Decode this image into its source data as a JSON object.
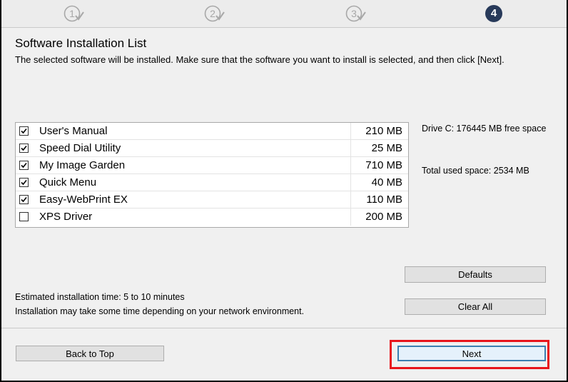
{
  "steps": [
    {
      "number": "1",
      "state": "done"
    },
    {
      "number": "2",
      "state": "done"
    },
    {
      "number": "3",
      "state": "done"
    },
    {
      "number": "4",
      "state": "current"
    }
  ],
  "header": {
    "title": "Software Installation List",
    "description": "The selected software will be installed. Make sure that the software you want to install is selected, and then click [Next]."
  },
  "software": [
    {
      "name": "User's Manual",
      "size": "210 MB",
      "checked": true
    },
    {
      "name": "Speed Dial Utility",
      "size": "25 MB",
      "checked": true
    },
    {
      "name": "My Image Garden",
      "size": "710 MB",
      "checked": true
    },
    {
      "name": "Quick Menu",
      "size": "40 MB",
      "checked": true
    },
    {
      "name": "Easy-WebPrint EX",
      "size": "110 MB",
      "checked": true
    },
    {
      "name": "XPS Driver",
      "size": "200 MB",
      "checked": false
    }
  ],
  "disk": {
    "drive_free": "Drive C: 176445 MB free space",
    "total_used": "Total used space: 2534 MB"
  },
  "buttons": {
    "defaults": "Defaults",
    "clear_all": "Clear All",
    "back_to_top": "Back to Top",
    "next": "Next"
  },
  "estimate": {
    "time": "Estimated installation time: 5 to 10 minutes",
    "note": "Installation may take some time depending on your network environment."
  },
  "colors": {
    "step_active": "#283a5a",
    "highlight": "#e8141b",
    "focus_border": "#3c7fb1"
  }
}
